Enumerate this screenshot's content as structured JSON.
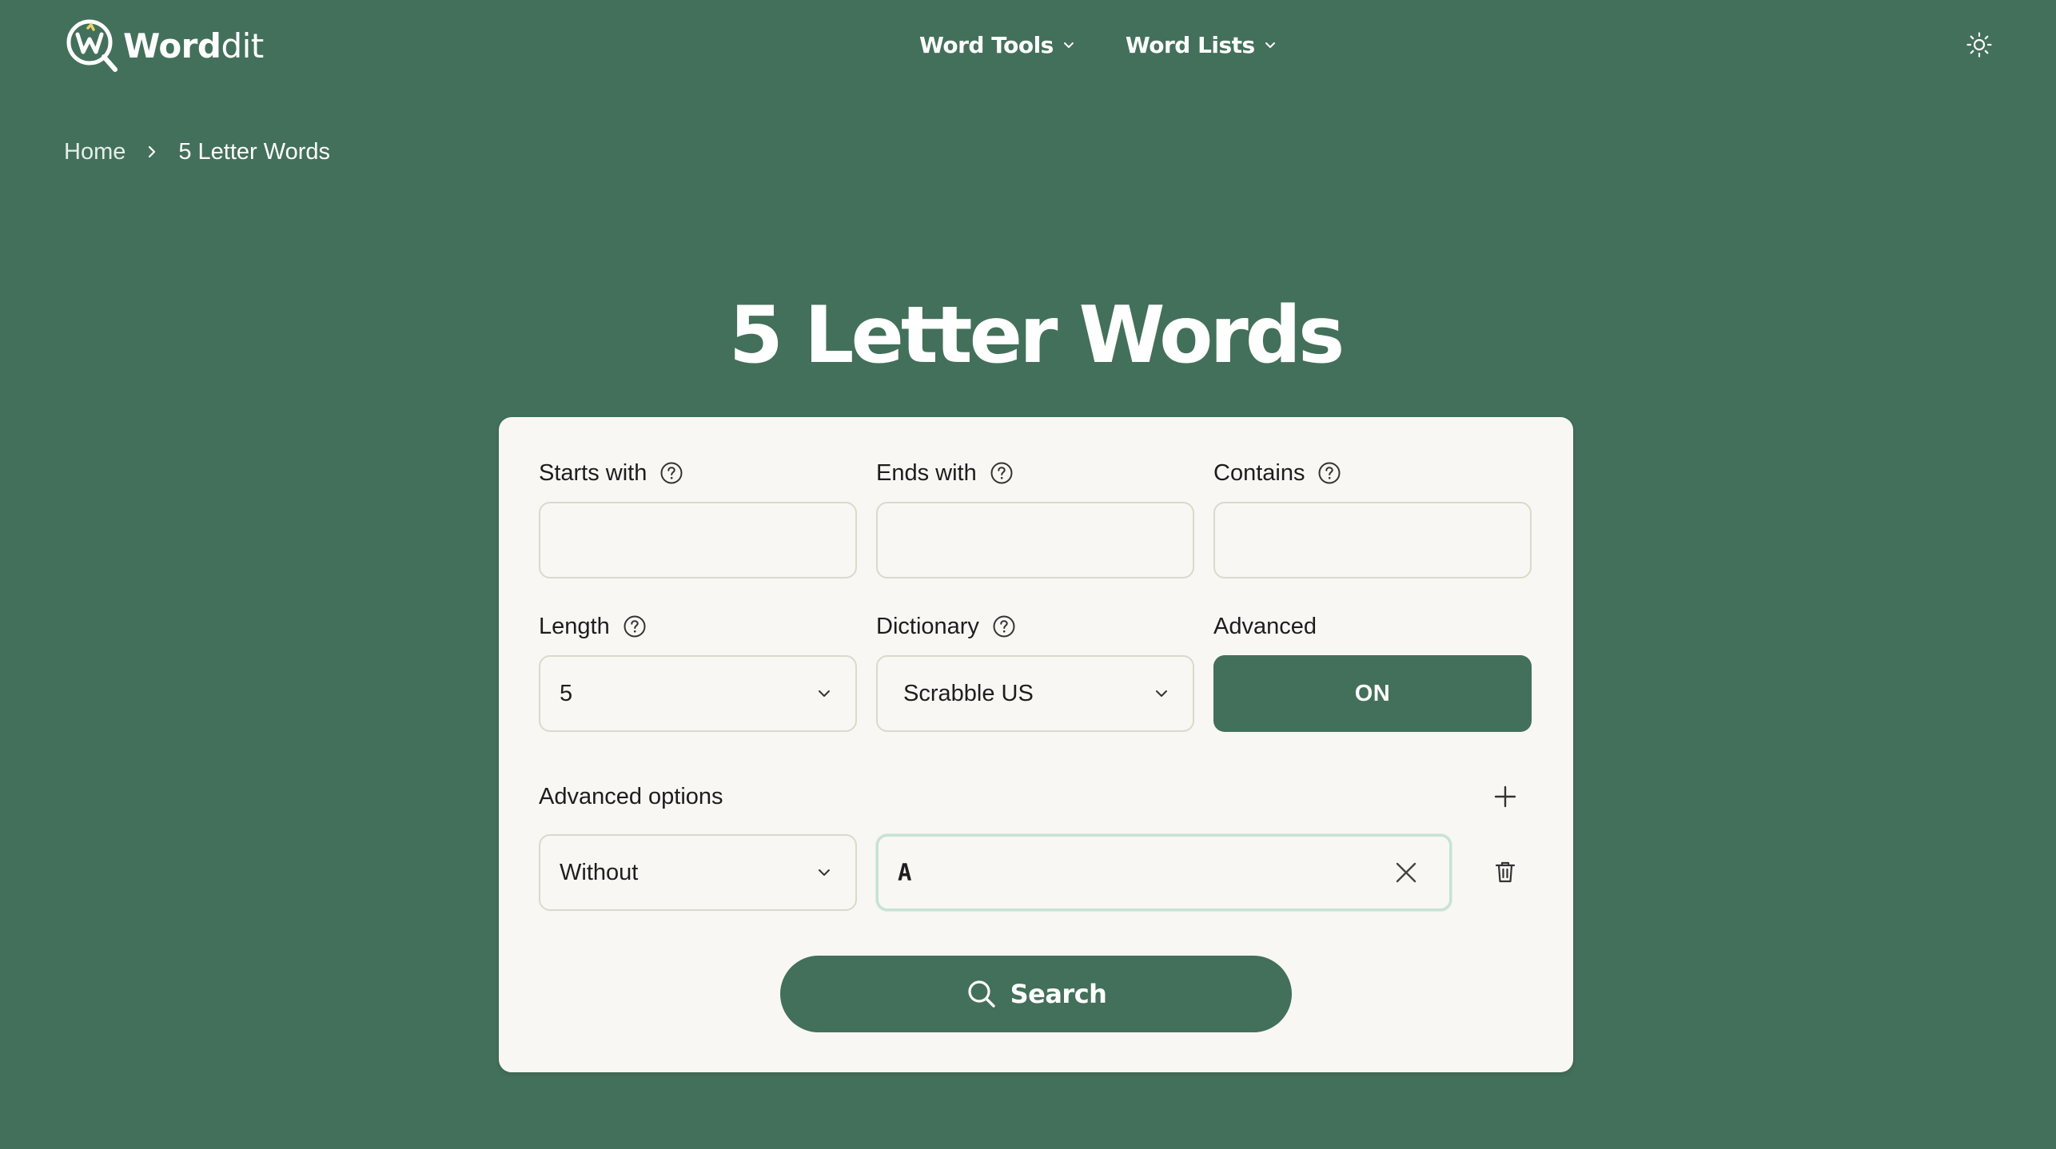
{
  "header": {
    "logo_bold": "Word",
    "logo_light": "dit",
    "nav": [
      {
        "label": "Word Tools",
        "icon": "chevron-down-icon"
      },
      {
        "label": "Word Lists",
        "icon": "chevron-down-icon"
      }
    ],
    "theme_icon": "sun-icon"
  },
  "breadcrumb": {
    "home": "Home",
    "separator_icon": "chevron-right-icon",
    "current": "5 Letter Words"
  },
  "title": "5 Letter Words",
  "form": {
    "starts_with": {
      "label": "Starts with",
      "value": "",
      "help_icon": "question-circle-icon"
    },
    "ends_with": {
      "label": "Ends with",
      "value": "",
      "help_icon": "question-circle-icon"
    },
    "contains": {
      "label": "Contains",
      "value": "",
      "help_icon": "question-circle-icon"
    },
    "length": {
      "label": "Length",
      "value": "5",
      "help_icon": "question-circle-icon"
    },
    "dictionary": {
      "label": "Dictionary",
      "value": "Scrabble US",
      "help_icon": "question-circle-icon"
    },
    "advanced": {
      "label": "Advanced",
      "value": "ON"
    },
    "advanced_options": {
      "label": "Advanced options",
      "add_icon": "plus-icon",
      "rows": [
        {
          "mode": "Without",
          "value": "A",
          "clear_icon": "close-icon",
          "delete_icon": "trash-icon"
        }
      ]
    },
    "search_label": "Search",
    "search_icon": "search-icon"
  },
  "colors": {
    "background": "#43705a",
    "card": "#f8f7f3",
    "accent": "#43705a",
    "input_border": "#dcd8cd",
    "focus_ring": "#c6e3d2"
  }
}
